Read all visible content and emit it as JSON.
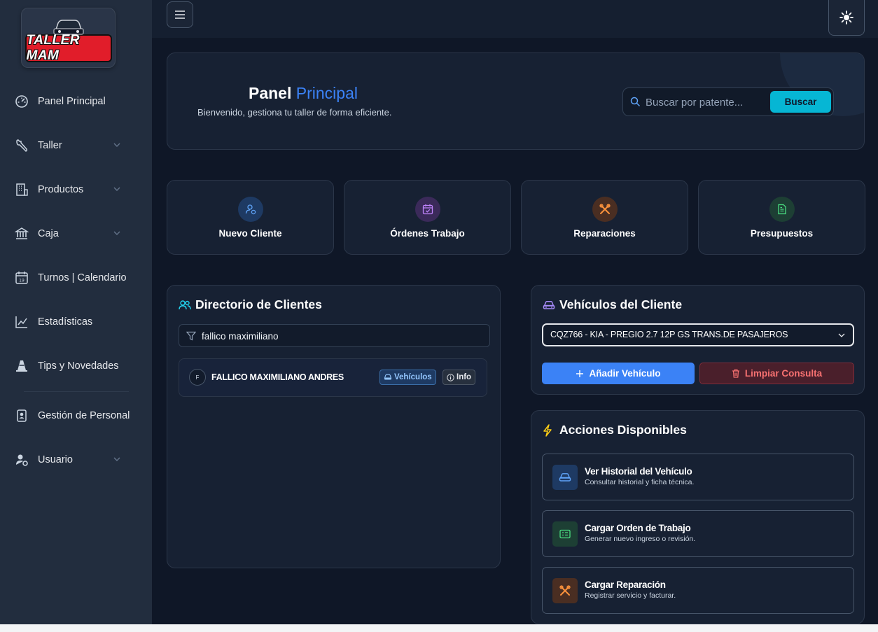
{
  "brand": {
    "logo_text": "TALLER MAM"
  },
  "sidebar": {
    "items": [
      {
        "label": "Panel Principal",
        "icon": "dashboard-icon",
        "has_submenu": false
      },
      {
        "label": "Taller",
        "icon": "wrench-icon",
        "has_submenu": true
      },
      {
        "label": "Productos",
        "icon": "building-icon",
        "has_submenu": true
      },
      {
        "label": "Caja",
        "icon": "bank-icon",
        "has_submenu": true
      },
      {
        "label": "Turnos | Calendario",
        "icon": "calendar-icon",
        "has_submenu": false
      },
      {
        "label": "Estadísticas",
        "icon": "chart-line-icon",
        "has_submenu": false
      },
      {
        "label": "Tips y Novedades",
        "icon": "traffic-cone-icon",
        "has_submenu": false
      },
      {
        "label": "Gestión de Personal",
        "icon": "badge-icon",
        "has_submenu": false
      },
      {
        "label": "Usuario",
        "icon": "user-gear-icon",
        "has_submenu": true
      }
    ]
  },
  "hero": {
    "title_main": "Panel",
    "title_accent": "Principal",
    "subtitle": "Bienvenido, gestiona tu taller de forma eficiente.",
    "search_placeholder": "Buscar por patente...",
    "search_button": "Buscar"
  },
  "quick_actions": [
    {
      "label": "Nuevo Cliente",
      "icon": "user-add-icon",
      "color": "#60a5fa",
      "bg": "#1e3a63"
    },
    {
      "label": "Órdenes Trabajo",
      "icon": "calendar-check-icon",
      "color": "#c084fc",
      "bg": "#3b2a5a"
    },
    {
      "label": "Reparaciones",
      "icon": "tools-icon",
      "color": "#fb923c",
      "bg": "#4a2e22"
    },
    {
      "label": "Presupuestos",
      "icon": "document-icon",
      "color": "#4ade80",
      "bg": "#1d3f34"
    }
  ],
  "clients_panel": {
    "title": "Directorio de Clientes",
    "filter_value": "fallico maximiliano",
    "clients": [
      {
        "initial": "F",
        "name": "FALLICO MAXIMILIANO ANDRES",
        "vehicles_label": "Vehículos",
        "info_label": "Info"
      }
    ]
  },
  "vehicles_panel": {
    "title": "Vehículos del Cliente",
    "selected_vehicle": "CQZ766 - KIA - PREGIO 2.7 12P GS TRANS.DE PASAJEROS",
    "add_button": "Añadir Vehículo",
    "clear_button": "Limpiar Consulta"
  },
  "actions_panel": {
    "title": "Acciones Disponibles",
    "actions": [
      {
        "title": "Ver Historial del Vehículo",
        "desc": "Consultar historial y ficha técnica.",
        "icon": "car-icon",
        "color": "#60a5fa",
        "bg": "#1e3a63"
      },
      {
        "title": "Cargar Orden de Trabajo",
        "desc": "Generar nuevo ingreso o revisión.",
        "icon": "clipboard-icon",
        "color": "#4ade80",
        "bg": "#1d3f34"
      },
      {
        "title": "Cargar Reparación",
        "desc": "Registrar servicio y facturar.",
        "icon": "tools-icon",
        "color": "#fb923c",
        "bg": "#4a2e22"
      }
    ]
  }
}
